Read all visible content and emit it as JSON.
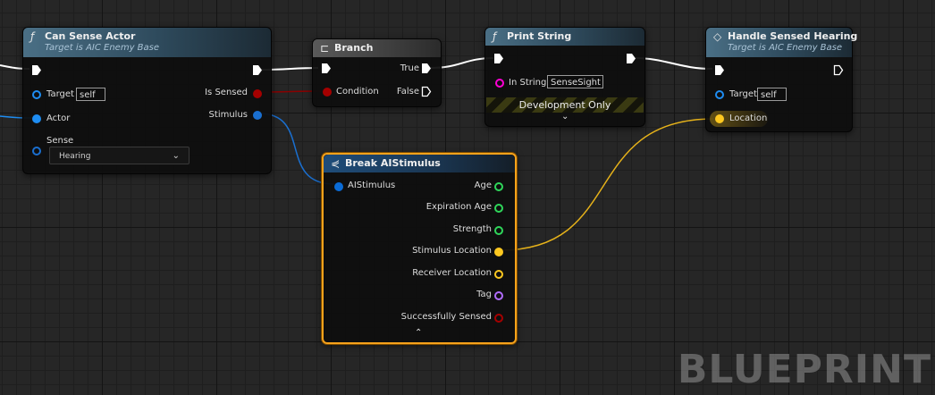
{
  "colors": {
    "exec": "#ffffff",
    "object": "#1e8df2",
    "bool": "#a50000",
    "struct": "#0a6bd6",
    "vector": "#fdc820",
    "float": "#2fd65a",
    "string": "#ff00d4",
    "name": "#b16cff",
    "selection": "#f7a21b"
  },
  "nodes": {
    "can_sense_actor": {
      "icon": "function-icon",
      "title": "Can Sense Actor",
      "subtitle": "Target is AIC Enemy Base",
      "pins": {
        "target_label": "Target",
        "target_value": "self",
        "actor_label": "Actor",
        "sense_label": "Sense",
        "sense_value": "Hearing",
        "is_sensed_label": "Is Sensed",
        "stimulus_label": "Stimulus"
      }
    },
    "branch": {
      "icon": "branch-icon",
      "title": "Branch",
      "pins": {
        "condition_label": "Condition",
        "true_label": "True",
        "false_label": "False"
      }
    },
    "print_string": {
      "icon": "function-icon",
      "title": "Print String",
      "pins": {
        "in_string_label": "In String",
        "in_string_value": "SenseSight"
      },
      "dev_only_label": "Development Only"
    },
    "handle_sensed_hearing": {
      "icon": "event-icon",
      "title": "Handle Sensed Hearing",
      "subtitle": "Target is AIC Enemy Base",
      "pins": {
        "target_label": "Target",
        "target_value": "self",
        "location_label": "Location"
      }
    },
    "break_ai_stimulus": {
      "icon": "break-struct-icon",
      "title": "Break AIStimulus",
      "pins": {
        "input_label": "AIStimulus",
        "outputs": [
          "Age",
          "Expiration Age",
          "Strength",
          "Stimulus Location",
          "Receiver Location",
          "Tag",
          "Successfully Sensed"
        ]
      }
    }
  },
  "watermark": "BLUEPRINT"
}
